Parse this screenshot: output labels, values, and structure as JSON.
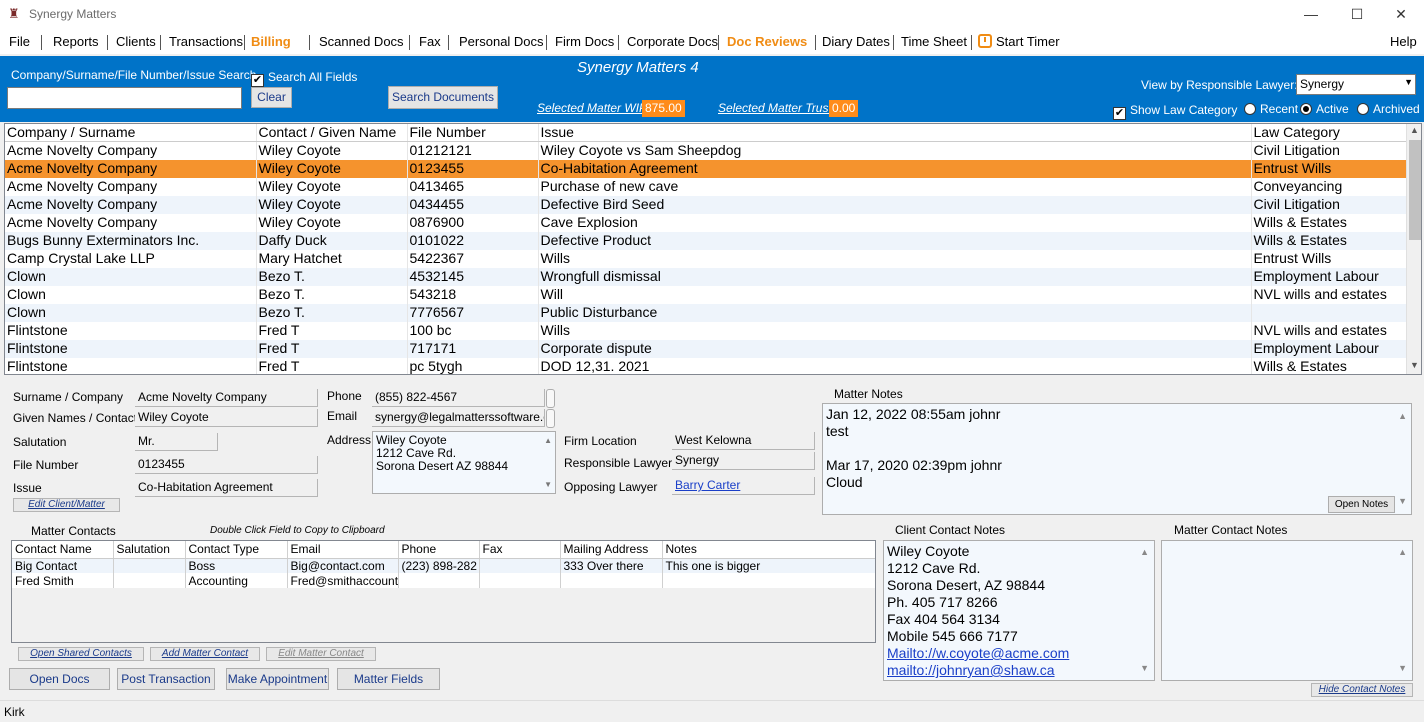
{
  "window": {
    "title": "Synergy Matters",
    "minimize": "—",
    "maximize": "☐",
    "close": "✕"
  },
  "menu": {
    "file": "File",
    "reports": "Reports",
    "clients": "Clients",
    "transactions": "Transactions",
    "billing": "Billing",
    "scanned_docs": "Scanned Docs",
    "fax": "Fax",
    "personal_docs": "Personal Docs",
    "firm_docs": "Firm Docs",
    "corporate_docs": "Corporate Docs",
    "doc_reviews": "Doc Reviews",
    "diary_dates": "Diary Dates",
    "time_sheet": "Time Sheet",
    "start_timer": "Start Timer",
    "help": "Help"
  },
  "search": {
    "label": "Company/Surname/File Number/Issue Search",
    "value": "",
    "search_all_label": "Search All Fields",
    "search_all_checked": "✔",
    "clear_label": "Clear",
    "search_docs_label": "Search Documents"
  },
  "app_title": "Synergy Matters 4",
  "wip": {
    "label": "Selected Matter WIP",
    "value": "875.00"
  },
  "trust": {
    "label": "Selected Matter Trust",
    "value": "0.00"
  },
  "view_by": {
    "label": "View by Responsible Lawyer:",
    "value": "Synergy"
  },
  "show_law_category": {
    "label": "Show Law Category",
    "checked": "✔"
  },
  "filter": {
    "recent": "Recent",
    "active": "Active",
    "archived": "Archived",
    "selected": "active"
  },
  "grid": {
    "headers": [
      "Company / Surname",
      "Contact / Given Name",
      "File Number",
      "Issue",
      "Law Category"
    ],
    "selected_index": 1,
    "rows": [
      [
        "Acme Novelty Company",
        "Wiley Coyote",
        "01212121",
        "Wiley Coyote vs Sam Sheepdog",
        "Civil Litigation"
      ],
      [
        "Acme Novelty Company",
        "Wiley Coyote",
        "0123455",
        "Co-Habitation Agreement",
        "Entrust Wills"
      ],
      [
        "Acme Novelty Company",
        "Wiley Coyote",
        "0413465",
        "Purchase of new cave",
        "Conveyancing"
      ],
      [
        "Acme Novelty Company",
        "Wiley Coyote",
        "0434455",
        "Defective Bird Seed",
        "Civil Litigation"
      ],
      [
        "Acme Novelty Company",
        "Wiley Coyote",
        "0876900",
        "Cave Explosion",
        "Wills & Estates"
      ],
      [
        "Bugs Bunny Exterminators Inc.",
        "Daffy Duck",
        "0101022",
        "Defective Product",
        "Wills & Estates"
      ],
      [
        "Camp Crystal Lake LLP",
        "Mary Hatchet",
        "5422367",
        "Wills",
        "Entrust Wills"
      ],
      [
        "Clown",
        "Bezo T.",
        "4532145",
        "Wrongfull dismissal",
        "Employment Labour"
      ],
      [
        "Clown",
        "Bezo T.",
        "543218",
        "Will",
        "NVL wills and estates"
      ],
      [
        "Clown",
        "Bezo T.",
        "7776567",
        "Public Disturbance",
        ""
      ],
      [
        "Flintstone",
        "Fred T",
        "100 bc",
        "Wills",
        "NVL wills and estates"
      ],
      [
        "Flintstone",
        "Fred T",
        "717171",
        "Corporate dispute",
        "Employment Labour"
      ],
      [
        "Flintstone",
        "Fred T",
        "pc 5tygh",
        "DOD 12,31. 2021",
        "Wills & Estates"
      ]
    ]
  },
  "detail": {
    "surname_label": "Surname / Company",
    "surname": "Acme Novelty Company",
    "given_label": "Given Names / Contact",
    "given": "Wiley Coyote",
    "salutation_label": "Salutation",
    "salutation": "Mr.",
    "file_label": "File Number",
    "file": "0123455",
    "issue_label": "Issue",
    "issue": "Co-Habitation Agreement",
    "phone_label": "Phone",
    "phone": "(855) 822-4567",
    "email_label": "Email",
    "email": "synergy@legalmatterssoftware.c",
    "address_label": "Address",
    "address": [
      "Wiley Coyote",
      "1212 Cave Rd.",
      "Sorona Desert AZ 98844"
    ],
    "firm_location_label": "Firm Location",
    "firm_location": "West Kelowna",
    "resp_lawyer_label": "Responsible Lawyer",
    "resp_lawyer": "Synergy",
    "opp_lawyer_label": "Opposing Lawyer",
    "opp_lawyer": "Barry Carter",
    "edit_client_label": "Edit Client/Matter"
  },
  "matter_notes": {
    "label": "Matter Notes",
    "lines": [
      "Jan 12, 2022 08:55am johnr",
      "test",
      "",
      "Mar 17, 2020 02:39pm johnr",
      "Cloud"
    ],
    "open_notes_label": "Open Notes"
  },
  "matter_contacts": {
    "label": "Matter Contacts",
    "hint": "Double Click Field to Copy to Clipboard",
    "headers": [
      "Contact Name",
      "Salutation",
      "Contact Type",
      "Email",
      "Phone",
      "Fax",
      "Mailing Address",
      "Notes"
    ],
    "rows": [
      [
        "Big Contact",
        "",
        "Boss",
        "Big@contact.com",
        "(223) 898-282",
        "",
        "333 Over there",
        "This one is bigger"
      ],
      [
        "Fred Smith",
        "",
        "Accounting",
        "Fred@smithaccounti",
        "",
        "",
        "",
        ""
      ]
    ],
    "open_shared_label": "Open Shared Contacts",
    "add_label": "Add Matter Contact",
    "edit_label": "Edit Matter Contact"
  },
  "client_contact_notes": {
    "label": "Client Contact Notes",
    "lines": [
      "Wiley Coyote",
      "1212 Cave Rd.",
      "Sorona Desert, AZ 98844",
      "Ph. 405 717 8266",
      "Fax 404 564 3134",
      "Mobile 545 666 7177"
    ],
    "links": [
      "Mailto://w.coyote@acme.com",
      "mailto://johnryan@shaw.ca"
    ]
  },
  "matter_contact_notes": {
    "label": "Matter Contact Notes"
  },
  "hide_contact_notes_label": "Hide Contact Notes",
  "buttons": {
    "open_docs": "Open Docs",
    "post_transaction": "Post Transaction",
    "make_appointment": "Make Appointment",
    "matter_fields": "Matter Fields"
  },
  "status": {
    "user": "Kirk"
  },
  "colors": {
    "accent_blue": "#0073c8",
    "highlight_orange": "#f5932d",
    "menu_orange": "#f08c14"
  }
}
